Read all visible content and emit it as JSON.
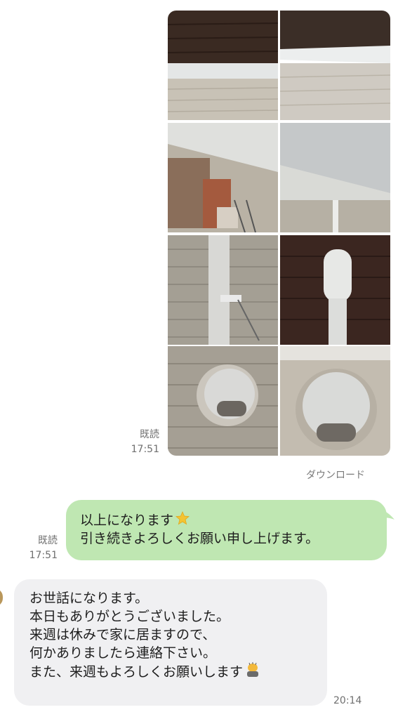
{
  "photo_grid": {
    "photos": [
      {
        "name": "eaves-board-left"
      },
      {
        "name": "eaves-board-right"
      },
      {
        "name": "soffit-painting-with-roller"
      },
      {
        "name": "soffit-painted"
      },
      {
        "name": "drainpipe-painting-with-roller"
      },
      {
        "name": "drainpipe-painted"
      },
      {
        "name": "vent-hood-painting"
      },
      {
        "name": "vent-hood-painted"
      }
    ],
    "read_label": "既読",
    "time": "17:51",
    "download_label": "ダウンロード"
  },
  "sent_message": {
    "lines": [
      "以上になります",
      "引き続きよろしくお願い申し上げます。"
    ],
    "emoji_icon": "sparkle-star-icon",
    "read_label": "既読",
    "time": "17:51",
    "bubble_color": "#bfe7b2"
  },
  "received_message": {
    "lines": [
      "お世話になります。",
      "本日もありがとうございました。",
      "来週は休みで家に居ますので、",
      "何かありましたら連絡下さい。",
      "また、来週もよろしくお願いします"
    ],
    "emoji_icon": "bowing-person-icon",
    "time": "20:14",
    "bubble_color": "#f0f0f2"
  }
}
